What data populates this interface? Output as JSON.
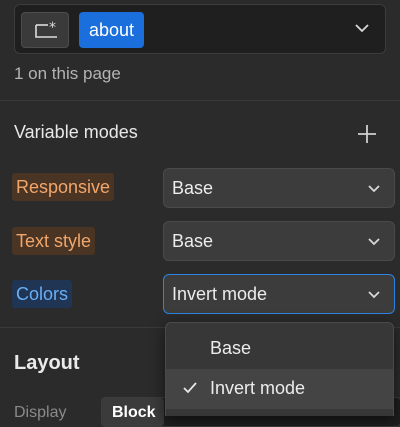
{
  "selector": {
    "icon": "selector-star-icon",
    "chip_label": "about",
    "count_text": "1 on this page"
  },
  "variable_modes": {
    "title": "Variable modes",
    "rows": [
      {
        "label": "Responsive",
        "value": "Base"
      },
      {
        "label": "Text style",
        "value": "Base"
      },
      {
        "label": "Colors",
        "value": "Invert mode"
      }
    ]
  },
  "dropdown": {
    "options": [
      "Base",
      "Invert mode"
    ],
    "selected": "Invert mode"
  },
  "layout": {
    "title": "Layout",
    "display_label": "Display",
    "display_value": "Block"
  },
  "colors": {
    "accent": "#1a6fdc",
    "orange_label": "#f1a66b",
    "blue_label": "#69aef5"
  }
}
